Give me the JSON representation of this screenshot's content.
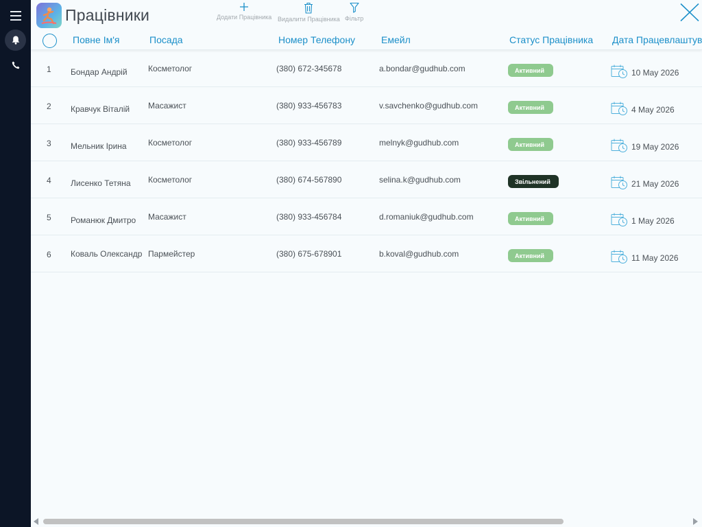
{
  "header": {
    "title": "Працівники",
    "accent_color": "#1b8fc9",
    "tools": {
      "add_label": "Додати Працівника",
      "delete_label": "Видалити Працівника",
      "filter_label": "Фільтр"
    }
  },
  "table": {
    "columns": {
      "name": "Повне Ім'я",
      "position": "Посада",
      "phone": "Номер Телефону",
      "email": "Емейл",
      "status": "Статус Працівника",
      "hire_date": "Дата Працевлаштування"
    },
    "rows": [
      {
        "num": "1",
        "name": "Бондар Андрій",
        "position": "Косметолог",
        "phone": "(380) 672-345678",
        "email": "a.bondar@gudhub.com",
        "status": "Активний",
        "status_type": "active",
        "date": "10 May 2026"
      },
      {
        "num": "2",
        "name": "Кравчук Віталій",
        "position": "Масажист",
        "phone": "(380) 933-456783",
        "email": "v.savchenko@gudhub.com",
        "status": "Активний",
        "status_type": "active",
        "date": "4 May 2026"
      },
      {
        "num": "3",
        "name": "Мельник Ірина",
        "position": "Косметолог",
        "phone": "(380) 933-456789",
        "email": "melnyk@gudhub.com",
        "status": "Активний",
        "status_type": "active",
        "date": "19 May 2026"
      },
      {
        "num": "4",
        "name": "Лисенко Тетяна",
        "position": "Косметолог",
        "phone": "(380) 674-567890",
        "email": "selina.k@gudhub.com",
        "status": "Звільнений",
        "status_type": "fired",
        "date": "21 May 2026"
      },
      {
        "num": "5",
        "name": "Романюк Дмитро",
        "position": "Масажист",
        "phone": "(380) 933-456784",
        "email": "d.romaniuk@gudhub.com",
        "status": "Активний",
        "status_type": "active",
        "date": "1 May 2026"
      },
      {
        "num": "6",
        "name": "Коваль Олександр",
        "position": "Пармейстер",
        "phone": "(380) 675-678901",
        "email": "b.koval@gudhub.com",
        "status": "Активний",
        "status_type": "active",
        "date": "11 May 2026"
      }
    ]
  },
  "status_colors": {
    "active": "#8fca8f",
    "fired": "#1f3326"
  },
  "icons": {
    "rail": [
      "menu-icon",
      "bell-icon",
      "phone-icon"
    ],
    "toolbar": [
      "plus-icon",
      "trash-icon",
      "filter-icon"
    ],
    "close": "close-icon",
    "date": "calendar-clock-icon"
  }
}
